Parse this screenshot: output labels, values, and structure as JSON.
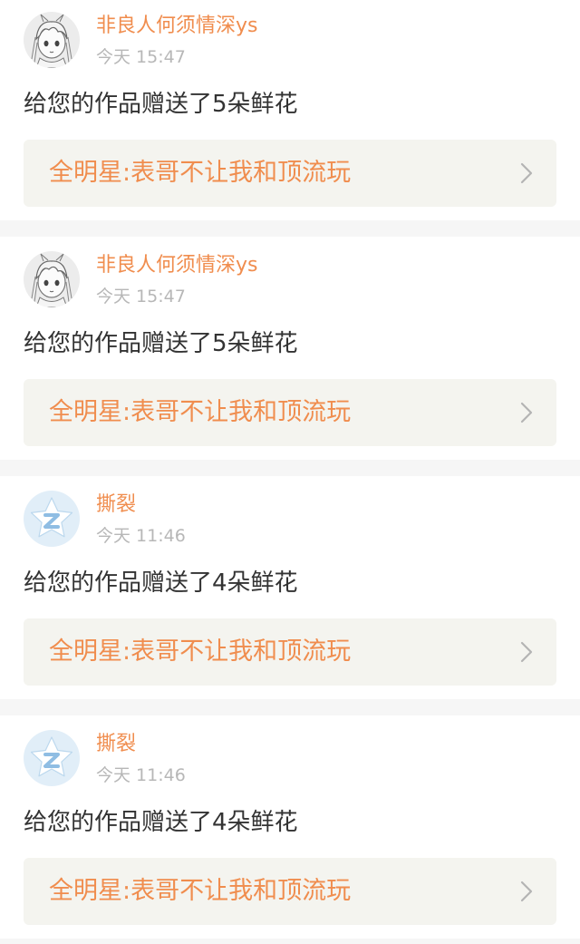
{
  "notifications": [
    {
      "avatar": "anime-girl-sketch-avatar",
      "username": "非良人何须情深ys",
      "time": "今天 15:47",
      "message": "给您的作品赠送了5朵鲜花",
      "work_title": "全明星:表哥不让我和顶流玩"
    },
    {
      "avatar": "anime-girl-sketch-avatar",
      "username": "非良人何须情深ys",
      "time": "今天 15:47",
      "message": "给您的作品赠送了5朵鲜花",
      "work_title": "全明星:表哥不让我和顶流玩"
    },
    {
      "avatar": "default-star-avatar",
      "username": "撕裂",
      "time": "今天 11:46",
      "message": "给您的作品赠送了4朵鲜花",
      "work_title": "全明星:表哥不让我和顶流玩"
    },
    {
      "avatar": "default-star-avatar",
      "username": "撕裂",
      "time": "今天 11:46",
      "message": "给您的作品赠送了4朵鲜花",
      "work_title": "全明星:表哥不让我和顶流玩"
    }
  ],
  "colors": {
    "accent": "#f08d4e",
    "time": "#b7b7b7",
    "text": "#333333",
    "link_bg": "#f4f4ef",
    "page_bg": "#f6f6f6"
  },
  "icons": {
    "chevron": "chevron-right-icon"
  }
}
